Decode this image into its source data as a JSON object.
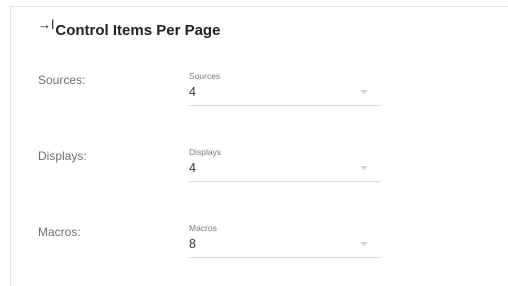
{
  "section": {
    "title": "Control Items Per Page",
    "title_icon": "→ǀ"
  },
  "rows": [
    {
      "row_label": "Sources:",
      "field_label": "Sources",
      "value": "4"
    },
    {
      "row_label": "Displays:",
      "field_label": "Displays",
      "value": "4"
    },
    {
      "row_label": "Macros:",
      "field_label": "Macros",
      "value": "8"
    }
  ],
  "icons": {
    "title_icon": "arrow-right-to-bar-icon",
    "dropdown_icon": "caret-down-icon"
  },
  "colors": {
    "title_text": "#222222",
    "label_text": "#6f6f6f",
    "underline": "#dcdcdc",
    "caret": "#d4d4d4"
  }
}
